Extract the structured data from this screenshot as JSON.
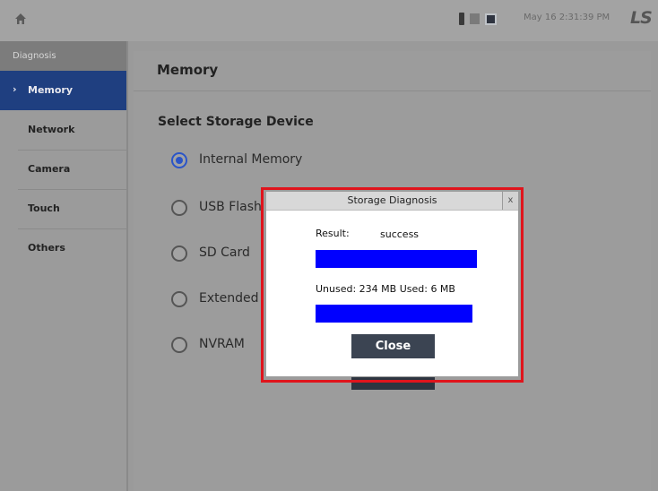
{
  "topbar": {
    "home_icon": "home-icon",
    "status_icons": [
      "usb-icon",
      "sd-card-icon",
      "network-icon"
    ],
    "datetime": "May 16 2:31:39 PM",
    "brand": "LS"
  },
  "sidebar": {
    "header": "Diagnosis",
    "items": [
      {
        "label": "Memory",
        "active": true
      },
      {
        "label": "Network",
        "active": false
      },
      {
        "label": "Camera",
        "active": false
      },
      {
        "label": "Touch",
        "active": false
      },
      {
        "label": "Others",
        "active": false
      }
    ]
  },
  "main": {
    "title": "Memory",
    "section_title": "Select Storage Device",
    "options": [
      {
        "label": "Internal Memory",
        "selected": true
      },
      {
        "label": "USB Flash",
        "selected": false
      },
      {
        "label": "SD Card",
        "selected": false
      },
      {
        "label": "Extended",
        "selected": false
      },
      {
        "label": "NVRAM",
        "selected": false
      }
    ]
  },
  "dialog": {
    "title": "Storage Diagnosis",
    "close_x": "x",
    "result_label": "Result:",
    "result_value": "success",
    "usage": "Unused: 234 MB Used: 6 MB",
    "close_button": "Close"
  },
  "colors": {
    "highlight": "#e0141c",
    "bar": "#0000ff",
    "active_nav": "#1f3f80",
    "radio_selected": "#2b55c7"
  }
}
